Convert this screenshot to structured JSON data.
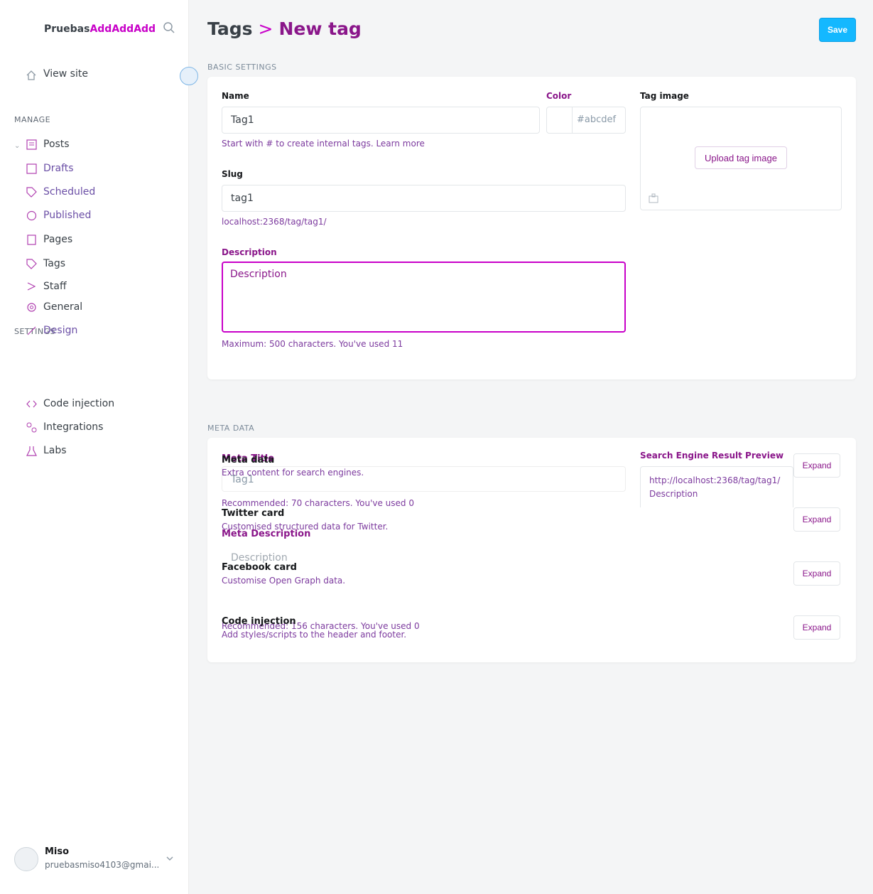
{
  "sidebar": {
    "site_name_a": "Pruebas",
    "site_name_b": "AddAddAdd",
    "view_site": "View site",
    "manage_heading": "MANAGE",
    "settings_heading": "SETTINGS",
    "items": [
      {
        "label": "Posts"
      },
      {
        "label": "Drafts"
      },
      {
        "label": "Scheduled"
      },
      {
        "label": "Published"
      },
      {
        "label": "Pages"
      },
      {
        "label": "Tags"
      },
      {
        "label": "Staff"
      },
      {
        "label": "General"
      },
      {
        "label": "Design"
      },
      {
        "label": "Code injection"
      },
      {
        "label": "Integrations"
      },
      {
        "label": "Labs"
      }
    ],
    "user": {
      "name": "Miso",
      "email": "pruebasmiso4103@gmai..."
    }
  },
  "header": {
    "parent": "Tags",
    "current": "New tag",
    "save_label": "Save"
  },
  "basic": {
    "section_title": "BASIC SETTINGS",
    "name_label": "Name",
    "name_value": "Tag1",
    "name_help": "Start with # to create internal tags. Learn more",
    "color_label": "Color",
    "color_placeholder": "#abcdef",
    "image_label": "Tag image",
    "upload_label": "Upload tag image",
    "slug_label": "Slug",
    "slug_value": "tag1",
    "slug_help": "localhost:2368/tag/tag1/",
    "desc_label": "Description",
    "desc_placeholder": "Description",
    "desc_help": "Maximum: 500 characters. You've used 11"
  },
  "meta": {
    "section_title": "META DATA",
    "meta_data_label": "Meta data",
    "meta_data_sub": "Extra content for search engines.",
    "meta_title_label": "Meta Title",
    "meta_title_value": "Tag1",
    "meta_title_help": "Recommended: 70 characters. You've used 0",
    "meta_desc_label": "Meta Description",
    "meta_desc_placeholder": "Description",
    "meta_desc_help": "Recommended: 156 characters. You've used 0",
    "serp_label": "Search Engine Result Preview",
    "serp_url": "http://localhost:2368/tag/tag1/",
    "serp_desc": "Description",
    "twitter_label": "Twitter card",
    "twitter_sub": "Customised structured data for Twitter.",
    "facebook_label": "Facebook card",
    "facebook_sub": "Customise Open Graph data.",
    "code_label": "Code injection",
    "code_sub": "Add styles/scripts to the header and footer.",
    "expand": "Expand"
  },
  "colors": {
    "accent": "#c800c8",
    "save": "#14b8ff"
  }
}
